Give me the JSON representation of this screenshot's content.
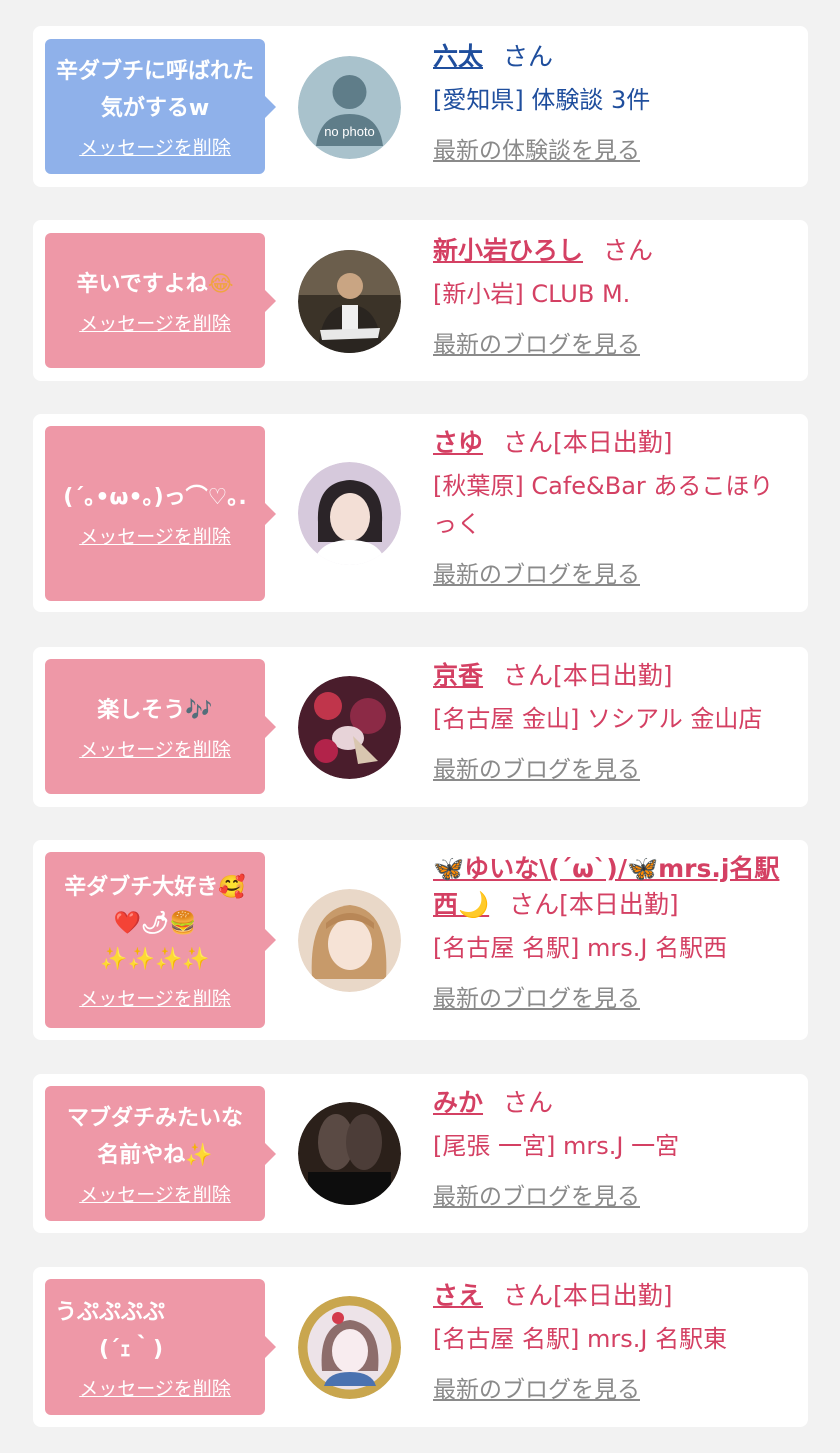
{
  "delete_label": "メッセージを削除",
  "san": "さん",
  "colors": {
    "background": "#f2f2f2",
    "bubble_blue": "#8fb1ea",
    "bubble_pink": "#ee98a7",
    "name_blue": "#1f4e9d",
    "name_pink": "#d44063",
    "link_gray": "#8a8a8a"
  },
  "items": [
    {
      "message": "辛ダブチに呼ばれた気がするw",
      "name": "六太",
      "san_suffix": "さん",
      "shop": "[愛知県] 体験談 3件",
      "link": "最新の体験談を見る",
      "avatar_text": "no photo"
    },
    {
      "message": "辛いですよね",
      "message_emoji": "😂",
      "name": "新小岩ひろし",
      "san_suffix": "さん",
      "shop": "[新小岩] CLUB M.",
      "link": "最新のブログを見る"
    },
    {
      "message": "(´｡•ω•｡)っ⌒♡｡.",
      "name": "さゆ",
      "san_suffix": "さん[本日出勤]",
      "shop": "[秋葉原] Cafe&Bar あるこほりっく",
      "link": "最新のブログを見る"
    },
    {
      "message": "楽しそう",
      "message_emoji": "🎶",
      "name": "京香",
      "san_suffix": "さん[本日出勤]",
      "shop": "[名古屋 金山] ソシアル 金山店",
      "link": "最新のブログを見る"
    },
    {
      "message": "辛ダブチ大好き🥰\n❤️🌶🍔\n✨✨✨✨",
      "name": "🦋ゆいな\\(´ω`)/🦋mrs.j名駅西🌙",
      "san_suffix": "さん[本日出勤]",
      "shop": "[名古屋 名駅] mrs.J 名駅西",
      "link": "最新のブログを見る"
    },
    {
      "message": "マブダチみたいな\n名前やね✨",
      "name": "みか",
      "san_suffix": "さん",
      "shop": "[尾張 一宮] mrs.J 一宮",
      "link": "最新のブログを見る"
    },
    {
      "message": "うぷぷぷぷ\n　　(´ｪ｀)",
      "name": "さえ",
      "san_suffix": "さん[本日出勤]",
      "shop": "[名古屋 名駅] mrs.J 名駅東",
      "link": "最新のブログを見る"
    }
  ]
}
